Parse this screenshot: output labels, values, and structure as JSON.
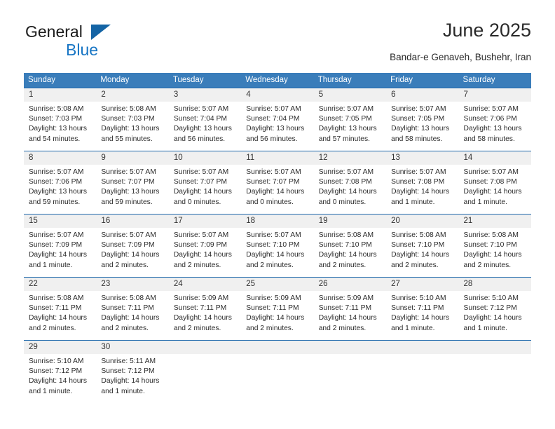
{
  "brand": {
    "name_part1": "General",
    "name_part2": "Blue",
    "triangle_color": "#1464a5",
    "blue_color": "#1775c4"
  },
  "header": {
    "title": "June 2025",
    "subtitle": "Bandar-e Genaveh, Bushehr, Iran"
  },
  "calendar": {
    "header_bg": "#3a7dba",
    "row_divider": "#1f69ac",
    "daynum_bg": "#f0f0f0",
    "weekdays": [
      "Sunday",
      "Monday",
      "Tuesday",
      "Wednesday",
      "Thursday",
      "Friday",
      "Saturday"
    ],
    "weeks": [
      [
        {
          "day": "1",
          "sunrise": "Sunrise: 5:08 AM",
          "sunset": "Sunset: 7:03 PM",
          "daylight_l1": "Daylight: 13 hours",
          "daylight_l2": "and 54 minutes."
        },
        {
          "day": "2",
          "sunrise": "Sunrise: 5:08 AM",
          "sunset": "Sunset: 7:03 PM",
          "daylight_l1": "Daylight: 13 hours",
          "daylight_l2": "and 55 minutes."
        },
        {
          "day": "3",
          "sunrise": "Sunrise: 5:07 AM",
          "sunset": "Sunset: 7:04 PM",
          "daylight_l1": "Daylight: 13 hours",
          "daylight_l2": "and 56 minutes."
        },
        {
          "day": "4",
          "sunrise": "Sunrise: 5:07 AM",
          "sunset": "Sunset: 7:04 PM",
          "daylight_l1": "Daylight: 13 hours",
          "daylight_l2": "and 56 minutes."
        },
        {
          "day": "5",
          "sunrise": "Sunrise: 5:07 AM",
          "sunset": "Sunset: 7:05 PM",
          "daylight_l1": "Daylight: 13 hours",
          "daylight_l2": "and 57 minutes."
        },
        {
          "day": "6",
          "sunrise": "Sunrise: 5:07 AM",
          "sunset": "Sunset: 7:05 PM",
          "daylight_l1": "Daylight: 13 hours",
          "daylight_l2": "and 58 minutes."
        },
        {
          "day": "7",
          "sunrise": "Sunrise: 5:07 AM",
          "sunset": "Sunset: 7:06 PM",
          "daylight_l1": "Daylight: 13 hours",
          "daylight_l2": "and 58 minutes."
        }
      ],
      [
        {
          "day": "8",
          "sunrise": "Sunrise: 5:07 AM",
          "sunset": "Sunset: 7:06 PM",
          "daylight_l1": "Daylight: 13 hours",
          "daylight_l2": "and 59 minutes."
        },
        {
          "day": "9",
          "sunrise": "Sunrise: 5:07 AM",
          "sunset": "Sunset: 7:07 PM",
          "daylight_l1": "Daylight: 13 hours",
          "daylight_l2": "and 59 minutes."
        },
        {
          "day": "10",
          "sunrise": "Sunrise: 5:07 AM",
          "sunset": "Sunset: 7:07 PM",
          "daylight_l1": "Daylight: 14 hours",
          "daylight_l2": "and 0 minutes."
        },
        {
          "day": "11",
          "sunrise": "Sunrise: 5:07 AM",
          "sunset": "Sunset: 7:07 PM",
          "daylight_l1": "Daylight: 14 hours",
          "daylight_l2": "and 0 minutes."
        },
        {
          "day": "12",
          "sunrise": "Sunrise: 5:07 AM",
          "sunset": "Sunset: 7:08 PM",
          "daylight_l1": "Daylight: 14 hours",
          "daylight_l2": "and 0 minutes."
        },
        {
          "day": "13",
          "sunrise": "Sunrise: 5:07 AM",
          "sunset": "Sunset: 7:08 PM",
          "daylight_l1": "Daylight: 14 hours",
          "daylight_l2": "and 1 minute."
        },
        {
          "day": "14",
          "sunrise": "Sunrise: 5:07 AM",
          "sunset": "Sunset: 7:08 PM",
          "daylight_l1": "Daylight: 14 hours",
          "daylight_l2": "and 1 minute."
        }
      ],
      [
        {
          "day": "15",
          "sunrise": "Sunrise: 5:07 AM",
          "sunset": "Sunset: 7:09 PM",
          "daylight_l1": "Daylight: 14 hours",
          "daylight_l2": "and 1 minute."
        },
        {
          "day": "16",
          "sunrise": "Sunrise: 5:07 AM",
          "sunset": "Sunset: 7:09 PM",
          "daylight_l1": "Daylight: 14 hours",
          "daylight_l2": "and 2 minutes."
        },
        {
          "day": "17",
          "sunrise": "Sunrise: 5:07 AM",
          "sunset": "Sunset: 7:09 PM",
          "daylight_l1": "Daylight: 14 hours",
          "daylight_l2": "and 2 minutes."
        },
        {
          "day": "18",
          "sunrise": "Sunrise: 5:07 AM",
          "sunset": "Sunset: 7:10 PM",
          "daylight_l1": "Daylight: 14 hours",
          "daylight_l2": "and 2 minutes."
        },
        {
          "day": "19",
          "sunrise": "Sunrise: 5:08 AM",
          "sunset": "Sunset: 7:10 PM",
          "daylight_l1": "Daylight: 14 hours",
          "daylight_l2": "and 2 minutes."
        },
        {
          "day": "20",
          "sunrise": "Sunrise: 5:08 AM",
          "sunset": "Sunset: 7:10 PM",
          "daylight_l1": "Daylight: 14 hours",
          "daylight_l2": "and 2 minutes."
        },
        {
          "day": "21",
          "sunrise": "Sunrise: 5:08 AM",
          "sunset": "Sunset: 7:10 PM",
          "daylight_l1": "Daylight: 14 hours",
          "daylight_l2": "and 2 minutes."
        }
      ],
      [
        {
          "day": "22",
          "sunrise": "Sunrise: 5:08 AM",
          "sunset": "Sunset: 7:11 PM",
          "daylight_l1": "Daylight: 14 hours",
          "daylight_l2": "and 2 minutes."
        },
        {
          "day": "23",
          "sunrise": "Sunrise: 5:08 AM",
          "sunset": "Sunset: 7:11 PM",
          "daylight_l1": "Daylight: 14 hours",
          "daylight_l2": "and 2 minutes."
        },
        {
          "day": "24",
          "sunrise": "Sunrise: 5:09 AM",
          "sunset": "Sunset: 7:11 PM",
          "daylight_l1": "Daylight: 14 hours",
          "daylight_l2": "and 2 minutes."
        },
        {
          "day": "25",
          "sunrise": "Sunrise: 5:09 AM",
          "sunset": "Sunset: 7:11 PM",
          "daylight_l1": "Daylight: 14 hours",
          "daylight_l2": "and 2 minutes."
        },
        {
          "day": "26",
          "sunrise": "Sunrise: 5:09 AM",
          "sunset": "Sunset: 7:11 PM",
          "daylight_l1": "Daylight: 14 hours",
          "daylight_l2": "and 2 minutes."
        },
        {
          "day": "27",
          "sunrise": "Sunrise: 5:10 AM",
          "sunset": "Sunset: 7:11 PM",
          "daylight_l1": "Daylight: 14 hours",
          "daylight_l2": "and 1 minute."
        },
        {
          "day": "28",
          "sunrise": "Sunrise: 5:10 AM",
          "sunset": "Sunset: 7:12 PM",
          "daylight_l1": "Daylight: 14 hours",
          "daylight_l2": "and 1 minute."
        }
      ],
      [
        {
          "day": "29",
          "sunrise": "Sunrise: 5:10 AM",
          "sunset": "Sunset: 7:12 PM",
          "daylight_l1": "Daylight: 14 hours",
          "daylight_l2": "and 1 minute."
        },
        {
          "day": "30",
          "sunrise": "Sunrise: 5:11 AM",
          "sunset": "Sunset: 7:12 PM",
          "daylight_l1": "Daylight: 14 hours",
          "daylight_l2": "and 1 minute."
        },
        {
          "day": "",
          "sunrise": "",
          "sunset": "",
          "daylight_l1": "",
          "daylight_l2": ""
        },
        {
          "day": "",
          "sunrise": "",
          "sunset": "",
          "daylight_l1": "",
          "daylight_l2": ""
        },
        {
          "day": "",
          "sunrise": "",
          "sunset": "",
          "daylight_l1": "",
          "daylight_l2": ""
        },
        {
          "day": "",
          "sunrise": "",
          "sunset": "",
          "daylight_l1": "",
          "daylight_l2": ""
        },
        {
          "day": "",
          "sunrise": "",
          "sunset": "",
          "daylight_l1": "",
          "daylight_l2": ""
        }
      ]
    ]
  }
}
